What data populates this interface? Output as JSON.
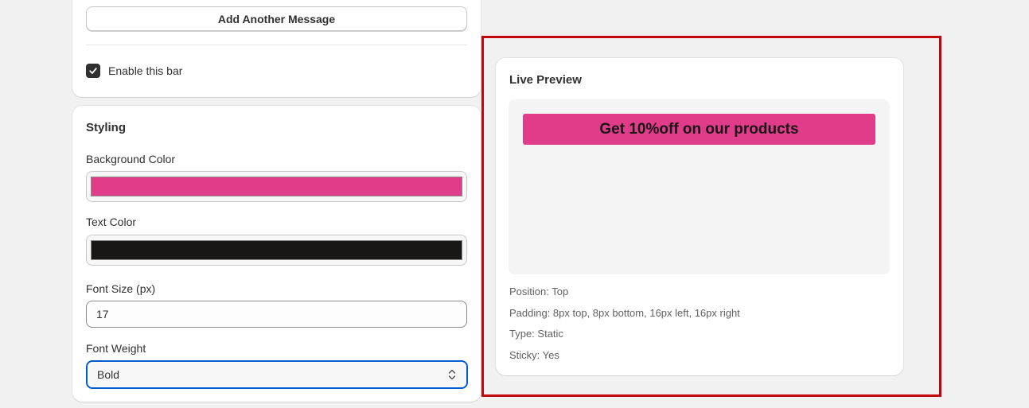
{
  "messages_card": {
    "add_button": "Add Another Message",
    "enable_label": "Enable this bar",
    "enable_checked": true
  },
  "styling": {
    "title": "Styling",
    "background_color_label": "Background Color",
    "background_color": "#e03c8a",
    "text_color_label": "Text Color",
    "text_color": "#191616",
    "font_size_label": "Font Size (px)",
    "font_size": "17",
    "font_weight_label": "Font Weight",
    "font_weight": "Bold"
  },
  "preview": {
    "title": "Live Preview",
    "banner_text": "Get 10%off on our products",
    "position": "Position: Top",
    "padding": "Padding: 8px top, 8px bottom, 16px left, 16px right",
    "type": "Type: Static",
    "sticky": "Sticky: Yes"
  },
  "colors": {
    "highlight_border": "#c4040f",
    "focus_ring": "#005bd3"
  },
  "icons": {
    "checkbox": "checkmark-icon",
    "select": "chevron-up-down-icon"
  }
}
